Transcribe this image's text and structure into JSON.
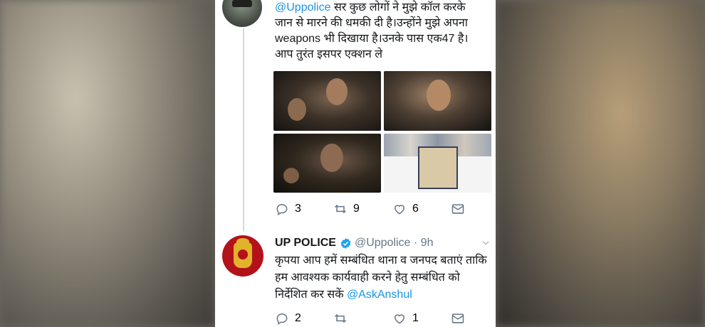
{
  "tweet1": {
    "mention": "@Uppolice",
    "text_line1": " सर कुछ लोगों ने मुझे कॉल करके",
    "text_rest": "जान से मारने की धमकी दी है।उन्होंने मुझे अपना weapons भी दिखाया है।उनके पास एक47 है। आप तुरंत इसपर एक्शन ले",
    "actions": {
      "replies": "3",
      "retweets": "9",
      "likes": "6"
    }
  },
  "tweet2": {
    "name": "UP POLICE",
    "handle": "@Uppolice",
    "separator": " · ",
    "time": "9h",
    "text": "कृपया आप हमें सम्बंधित थाना व जनपद बताएं ताकि हम आवश्यक कार्यवाही करने हेतु सम्बंधित को निर्देशित कर सकें ",
    "mention": "@AskAnshul",
    "actions": {
      "replies": "2",
      "retweets": "",
      "likes": "1"
    }
  },
  "icons": {
    "reply": "reply-icon",
    "retweet": "retweet-icon",
    "like": "heart-icon",
    "dm": "envelope-icon",
    "verified": "verified-badge-icon",
    "chevron": "chevron-down-icon"
  },
  "colors": {
    "link": "#1b95e0",
    "text": "#14171a",
    "muted": "#657786",
    "verified": "#1da1f2"
  }
}
